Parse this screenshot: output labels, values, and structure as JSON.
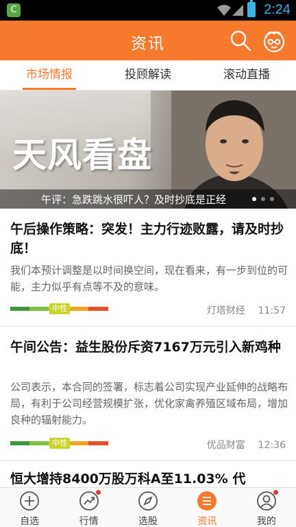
{
  "status_bar": {
    "app_badge": "C",
    "time": "2:24",
    "icons": [
      "wifi-icon",
      "signal-icon",
      "battery-icon"
    ],
    "time_color": "#33b5e5"
  },
  "header": {
    "title": "资讯",
    "background": "#f7792c",
    "icons": [
      "search-icon",
      "user-avatar-icon"
    ]
  },
  "tabs": [
    {
      "label": "市场情报",
      "active": true
    },
    {
      "label": "投顾解读",
      "active": false
    },
    {
      "label": "滚动直播",
      "active": false
    }
  ],
  "banner": {
    "headline": "天风看盘",
    "caption": "午评：急跌跳水很吓人？及时抄底是正经",
    "slide_count": 3,
    "current_slide": 1
  },
  "news": [
    {
      "title": "午后操作策略：突发！主力行迹败露，请及时抄底！",
      "summary": "我们本预计调整是以时间换空间，现在看来，有一步到位的可能，主力似乎有点等不及的意味。",
      "sentiment": "中性",
      "source": "灯塔财经",
      "time": "11:57"
    },
    {
      "title": "午间公告：益生股份斥资7167万元引入新鸡种",
      "summary": "公司表示，本合同的签署，标志着公司实现产业延伸的战略布局，有利于公司经营规模扩张，优化家禽养殖区域布局，增加良种的辐射能力。",
      "sentiment": "中性",
      "source": "优品财富",
      "time": "12:36"
    },
    {
      "title": "恒大增持8400万股万科A至11.03% 代",
      "summary": "",
      "sentiment": "",
      "source": "",
      "time": ""
    }
  ],
  "sentiment_colors": [
    "#3a9a3a",
    "#7cc142",
    "#c8d42a",
    "#f2a51f",
    "#f26a1b",
    "#d93a2b"
  ],
  "bottom_nav": [
    {
      "label": "自选",
      "icon": "plus-circle-icon",
      "active": false,
      "badge": false
    },
    {
      "label": "行情",
      "icon": "trend-chart-icon",
      "active": false,
      "badge": true
    },
    {
      "label": "选股",
      "icon": "compass-icon",
      "active": false,
      "badge": false
    },
    {
      "label": "资讯",
      "icon": "news-list-icon",
      "active": true,
      "badge": false
    },
    {
      "label": "我的",
      "icon": "profile-icon",
      "active": false,
      "badge": true
    }
  ]
}
